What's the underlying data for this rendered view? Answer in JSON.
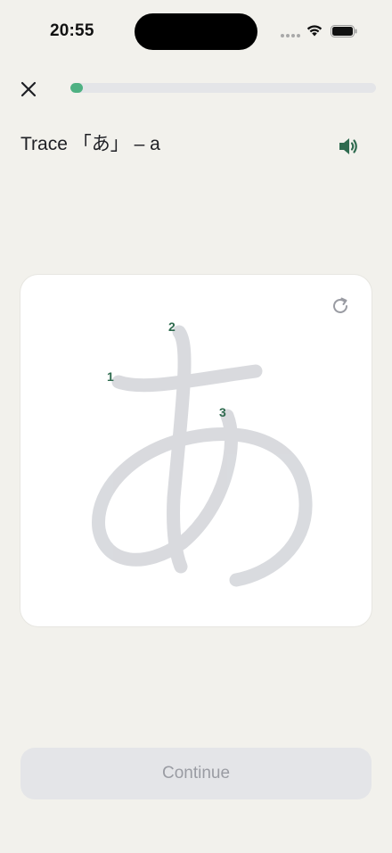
{
  "status_bar": {
    "time": "20:55"
  },
  "header": {
    "progress_fraction": 0.04
  },
  "prompt": {
    "text": "Trace 「あ」 – a"
  },
  "trace_card": {
    "character": "あ",
    "stroke_numbers": [
      "1",
      "2",
      "3"
    ]
  },
  "continue_button": {
    "label": "Continue"
  },
  "icons": {
    "close": "close-icon",
    "speaker": "speaker-icon",
    "reset": "reset-icon"
  },
  "colors": {
    "background": "#f2f1ec",
    "accent": "#4eb182",
    "stroke_number": "#2f6b4f",
    "guide_stroke": "#d7d9dd",
    "speaker": "#2f6b4f"
  }
}
